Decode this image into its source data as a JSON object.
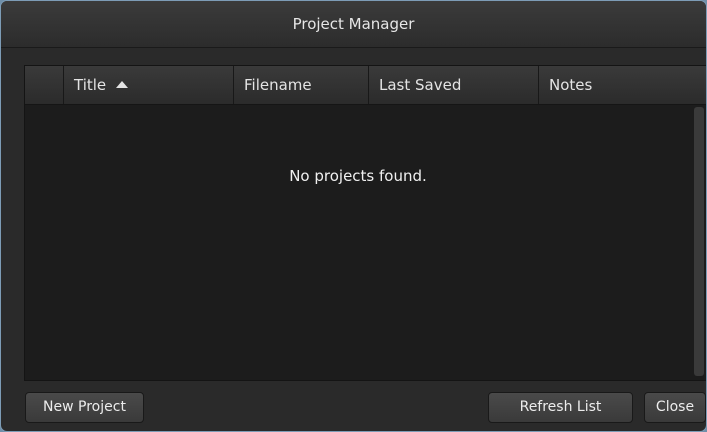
{
  "window": {
    "title": "Project Manager"
  },
  "table": {
    "columns": [
      {
        "label": ""
      },
      {
        "label": "Title",
        "sort": "ascending"
      },
      {
        "label": "Filename"
      },
      {
        "label": "Last Saved"
      },
      {
        "label": "Notes"
      }
    ],
    "rows": [],
    "empty_message": "No projects found."
  },
  "buttons": {
    "new_project": "New Project",
    "refresh_list": "Refresh List",
    "close": "Close"
  },
  "icons": {
    "sort": "triangle-up-icon"
  }
}
